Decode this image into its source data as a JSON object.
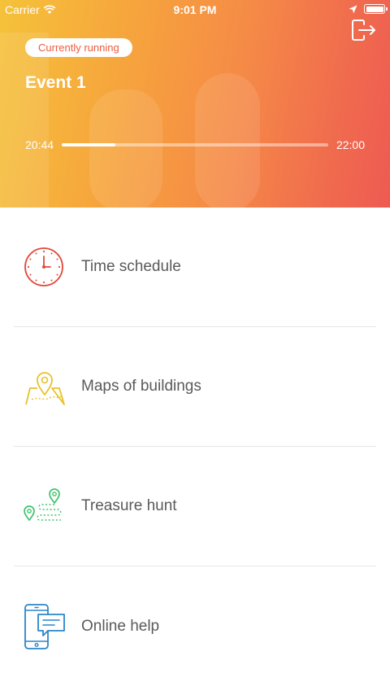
{
  "status_bar": {
    "carrier": "Carrier",
    "time": "9:01 PM"
  },
  "hero": {
    "badge": "Currently running",
    "title": "Event 1",
    "start_time": "20:44",
    "end_time": "22:00",
    "progress": 0.2
  },
  "menu": [
    {
      "label": "Time schedule",
      "icon": "clock-icon",
      "color": "#e04a3c"
    },
    {
      "label": "Maps of buildings",
      "icon": "map-pin-icon",
      "color": "#e8c12a"
    },
    {
      "label": "Treasure hunt",
      "icon": "route-pins-icon",
      "color": "#3fc46d"
    },
    {
      "label": "Online help",
      "icon": "phone-chat-icon",
      "color": "#2a86c8"
    }
  ]
}
